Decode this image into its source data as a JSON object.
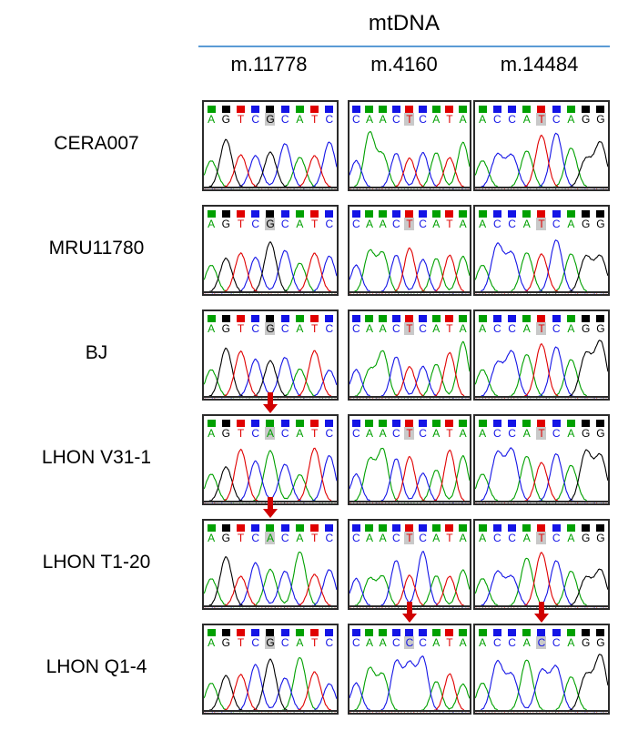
{
  "figure": {
    "title": "mtDNA",
    "columns": [
      {
        "id": "m11778",
        "label": "m.11778"
      },
      {
        "id": "m4160",
        "label": "m.4160"
      },
      {
        "id": "m14484",
        "label": "m.14484"
      }
    ],
    "colors": {
      "header_rule": "#5B9BD5",
      "arrow": "#D00000",
      "base_A": "#00A000",
      "base_C": "#1414E6",
      "base_G": "#000000",
      "base_T": "#E00000",
      "highlight": "#c9c9c9",
      "panel_border": "#2b2b2b"
    }
  },
  "rows": [
    {
      "label": "CERA007",
      "panels": [
        {
          "column": "m.11778",
          "sequence": "AGTCGCATC",
          "highlight_index": 4,
          "highlight_base": "G",
          "arrow": false
        },
        {
          "column": "m.4160",
          "sequence": "CAACTCATA",
          "highlight_index": 4,
          "highlight_base": "T",
          "arrow": false
        },
        {
          "column": "m.14484",
          "sequence": "ACCATCAGG",
          "highlight_index": 4,
          "highlight_base": "T",
          "arrow": false
        }
      ]
    },
    {
      "label": "MRU11780",
      "panels": [
        {
          "column": "m.11778",
          "sequence": "AGTCGCATC",
          "highlight_index": 4,
          "highlight_base": "G",
          "arrow": false
        },
        {
          "column": "m.4160",
          "sequence": "CAACTCATA",
          "highlight_index": 4,
          "highlight_base": "T",
          "arrow": false
        },
        {
          "column": "m.14484",
          "sequence": "ACCATCAGG",
          "highlight_index": 4,
          "highlight_base": "T",
          "arrow": false
        }
      ]
    },
    {
      "label": "BJ",
      "panels": [
        {
          "column": "m.11778",
          "sequence": "AGTCGCATC",
          "highlight_index": 4,
          "highlight_base": "G",
          "arrow": false
        },
        {
          "column": "m.4160",
          "sequence": "CAACTCATA",
          "highlight_index": 4,
          "highlight_base": "T",
          "arrow": false
        },
        {
          "column": "m.14484",
          "sequence": "ACCATCAGG",
          "highlight_index": 4,
          "highlight_base": "T",
          "arrow": false
        }
      ]
    },
    {
      "label": "LHON V31-1",
      "panels": [
        {
          "column": "m.11778",
          "sequence": "AGTCACATC",
          "highlight_index": 4,
          "highlight_base": "A",
          "arrow": true
        },
        {
          "column": "m.4160",
          "sequence": "CAACTCATA",
          "highlight_index": 4,
          "highlight_base": "T",
          "arrow": false
        },
        {
          "column": "m.14484",
          "sequence": "ACCATCAGG",
          "highlight_index": 4,
          "highlight_base": "T",
          "arrow": false
        }
      ]
    },
    {
      "label": "LHON T1-20",
      "panels": [
        {
          "column": "m.11778",
          "sequence": "AGTCACATC",
          "highlight_index": 4,
          "highlight_base": "A",
          "arrow": true
        },
        {
          "column": "m.4160",
          "sequence": "CAACTCATA",
          "highlight_index": 4,
          "highlight_base": "T",
          "arrow": false
        },
        {
          "column": "m.14484",
          "sequence": "ACCATCAGG",
          "highlight_index": 4,
          "highlight_base": "T",
          "arrow": false
        }
      ]
    },
    {
      "label": "LHON Q1-4",
      "panels": [
        {
          "column": "m.11778",
          "sequence": "AGTCGCATC",
          "highlight_index": 4,
          "highlight_base": "G",
          "arrow": false
        },
        {
          "column": "m.4160",
          "sequence": "CAACCCATA",
          "highlight_index": 4,
          "highlight_base": "C",
          "arrow": true
        },
        {
          "column": "m.14484",
          "sequence": "ACCACCAGG",
          "highlight_index": 4,
          "highlight_base": "C",
          "arrow": true
        }
      ]
    }
  ]
}
